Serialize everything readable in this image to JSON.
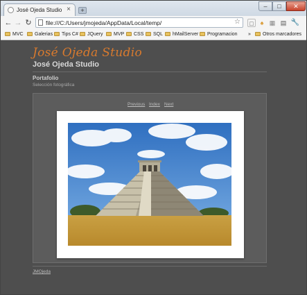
{
  "browser": {
    "tab_title": "José Ojeda Studio",
    "tab_close": "×",
    "new_tab": "+",
    "controls": {
      "minimize": "–",
      "maximize": "□",
      "close": "✕"
    },
    "url": "file:///C:/Users/jmojeda/AppData/Local/temp/",
    "bookmarks": [
      "MVC",
      "Galerias",
      "Tips C#",
      "JQuery",
      "MVP",
      "CSS",
      "SQL",
      "hMailServer",
      "Programacion",
      "Otros marcadores"
    ],
    "bookmarks_overflow": "»"
  },
  "page": {
    "logo_text": "José Ojeda Studio",
    "site_title": "José Ojeda Studio",
    "section_title": "Portafolio",
    "section_subtitle": "Selección fotográfica",
    "gallery_nav": {
      "previous": "Previous",
      "index": "Index",
      "next": "Next"
    },
    "footer_link": "JMOjeda"
  },
  "colors": {
    "page_background": "#4e4e4e",
    "logo": "#d87a2e",
    "gallery_panel": "#5c5c5c"
  }
}
